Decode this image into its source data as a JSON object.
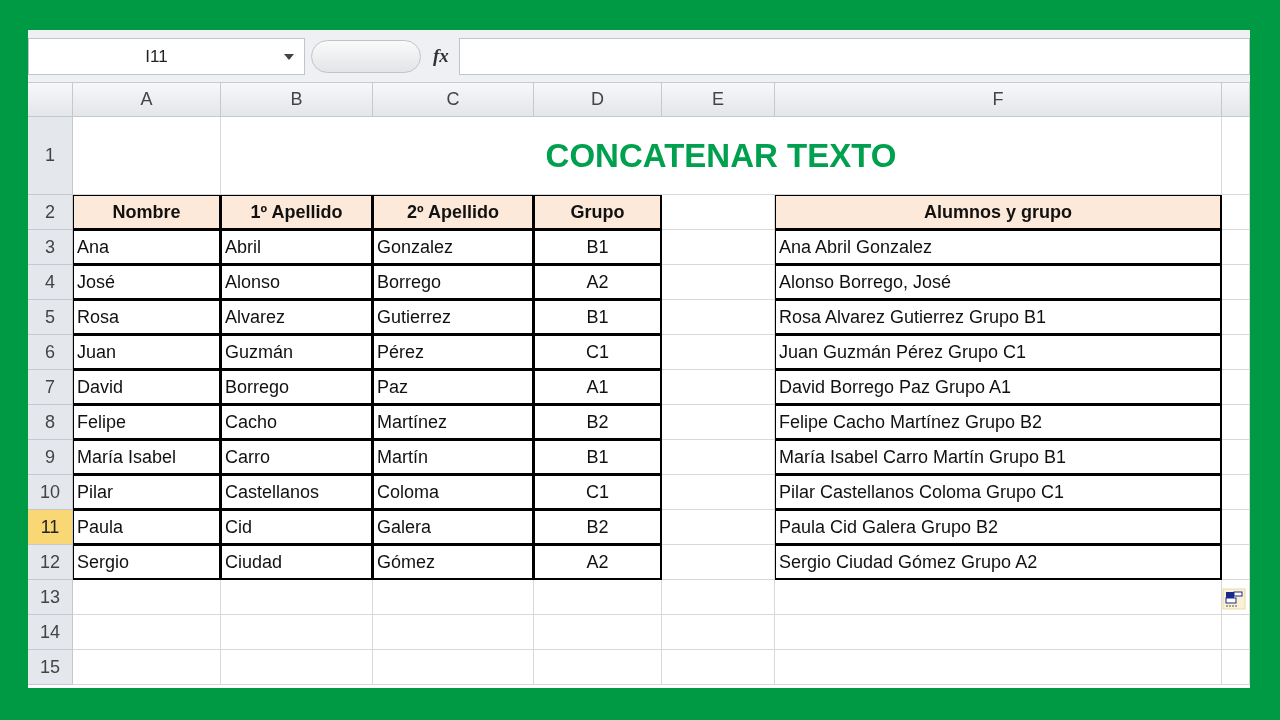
{
  "name_box": "I11",
  "formula_bar": {
    "function_label": "fx"
  },
  "column_headers": [
    {
      "label": "A"
    },
    {
      "label": "B"
    },
    {
      "label": "C"
    },
    {
      "label": "D"
    },
    {
      "label": "E"
    },
    {
      "label": "F"
    }
  ],
  "row_headers": [
    {
      "label": "1",
      "selected": false
    },
    {
      "label": "2",
      "selected": false
    },
    {
      "label": "3",
      "selected": false
    },
    {
      "label": "4",
      "selected": false
    },
    {
      "label": "5",
      "selected": false
    },
    {
      "label": "6",
      "selected": false
    },
    {
      "label": "7",
      "selected": false
    },
    {
      "label": "8",
      "selected": false
    },
    {
      "label": "9",
      "selected": false
    },
    {
      "label": "10",
      "selected": false
    },
    {
      "label": "11",
      "selected": true
    },
    {
      "label": "12",
      "selected": false
    },
    {
      "label": "13",
      "selected": false
    },
    {
      "label": "14",
      "selected": false
    },
    {
      "label": "15",
      "selected": false
    }
  ],
  "title": "CONCATENAR TEXTO",
  "table": {
    "columns": [
      "Nombre",
      "1º Apellido",
      "2º Apellido",
      "Grupo"
    ],
    "rows": [
      [
        "Ana",
        "Abril",
        "Gonzalez",
        "B1"
      ],
      [
        "José",
        "Alonso",
        "Borrego",
        "A2"
      ],
      [
        "Rosa",
        "Alvarez",
        "Gutierrez",
        "B1"
      ],
      [
        "Juan",
        "Guzmán",
        "Pérez",
        "C1"
      ],
      [
        "David",
        "Borrego",
        "Paz",
        "A1"
      ],
      [
        "Felipe",
        "Cacho",
        "Martínez",
        "B2"
      ],
      [
        "María Isabel",
        "Carro",
        "Martín",
        "B1"
      ],
      [
        "Pilar",
        "Castellanos",
        "Coloma",
        "C1"
      ],
      [
        "Paula",
        "Cid",
        "Galera",
        "B2"
      ],
      [
        "Sergio",
        "Ciudad",
        "Gómez",
        "A2"
      ]
    ]
  },
  "result": {
    "column": "Alumnos y grupo",
    "rows": [
      "Ana Abril Gonzalez",
      "Alonso Borrego, José",
      "Rosa Alvarez Gutierrez Grupo B1",
      "Juan Guzmán Pérez Grupo C1",
      "David Borrego Paz Grupo A1",
      "Felipe Cacho Martínez Grupo B2",
      "María Isabel Carro Martín Grupo B1",
      "Pilar Castellanos Coloma Grupo C1",
      "Paula Cid Galera Grupo B2",
      "Sergio Ciudad Gómez Grupo A2"
    ]
  }
}
